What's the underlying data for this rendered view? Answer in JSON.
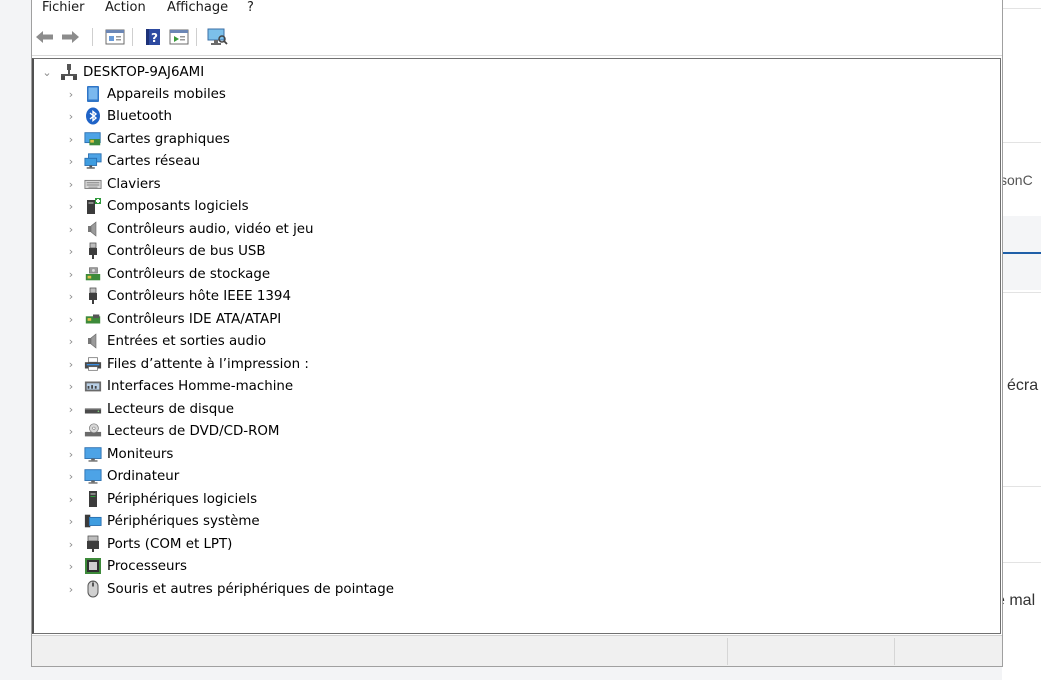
{
  "menu": {
    "items": [
      "Fichier",
      "Action",
      "Affichage",
      "?"
    ]
  },
  "toolbar": {
    "buttons": [
      "back-arrow-icon",
      "forward-arrow-icon",
      "properties-icon",
      "help-icon",
      "update-driver-icon",
      "scan-hardware-icon"
    ]
  },
  "tree": {
    "root": "DESKTOP-9AJ6AMI",
    "categories": [
      {
        "label": "Appareils mobiles",
        "icon": "mobile-device-icon"
      },
      {
        "label": "Bluetooth",
        "icon": "bluetooth-icon"
      },
      {
        "label": "Cartes graphiques",
        "icon": "display-adapter-icon"
      },
      {
        "label": "Cartes réseau",
        "icon": "network-adapter-icon"
      },
      {
        "label": "Claviers",
        "icon": "keyboard-icon"
      },
      {
        "label": "Composants logiciels",
        "icon": "software-component-icon"
      },
      {
        "label": "Contrôleurs audio, vidéo et jeu",
        "icon": "speaker-icon"
      },
      {
        "label": "Contrôleurs de bus USB",
        "icon": "usb-icon"
      },
      {
        "label": "Contrôleurs de stockage",
        "icon": "storage-controller-icon"
      },
      {
        "label": "Contrôleurs hôte IEEE 1394",
        "icon": "ieee1394-icon"
      },
      {
        "label": "Contrôleurs IDE ATA/ATAPI",
        "icon": "ide-controller-icon"
      },
      {
        "label": "Entrées et sorties audio",
        "icon": "audio-io-icon"
      },
      {
        "label": "Files d’attente à l’impression :",
        "icon": "printer-icon"
      },
      {
        "label": "Interfaces Homme-machine",
        "icon": "hid-icon"
      },
      {
        "label": "Lecteurs de disque",
        "icon": "disk-drive-icon"
      },
      {
        "label": "Lecteurs de DVD/CD-ROM",
        "icon": "dvd-drive-icon"
      },
      {
        "label": "Moniteurs",
        "icon": "monitor-icon"
      },
      {
        "label": "Ordinateur",
        "icon": "computer-icon"
      },
      {
        "label": "Périphériques logiciels",
        "icon": "software-device-icon"
      },
      {
        "label": "Périphériques système",
        "icon": "system-device-icon"
      },
      {
        "label": "Ports (COM et LPT)",
        "icon": "port-icon"
      },
      {
        "label": "Processeurs",
        "icon": "processor-icon"
      },
      {
        "label": "Souris et autres périphériques de pointage",
        "icon": "mouse-icon"
      }
    ]
  },
  "background_app": {
    "fragments": [
      "sonC",
      "écra",
      "e mal"
    ]
  },
  "colors": {
    "accent": "#1f5fa8",
    "tree_border": "#707070",
    "statusbar": "#f0f0f0"
  }
}
